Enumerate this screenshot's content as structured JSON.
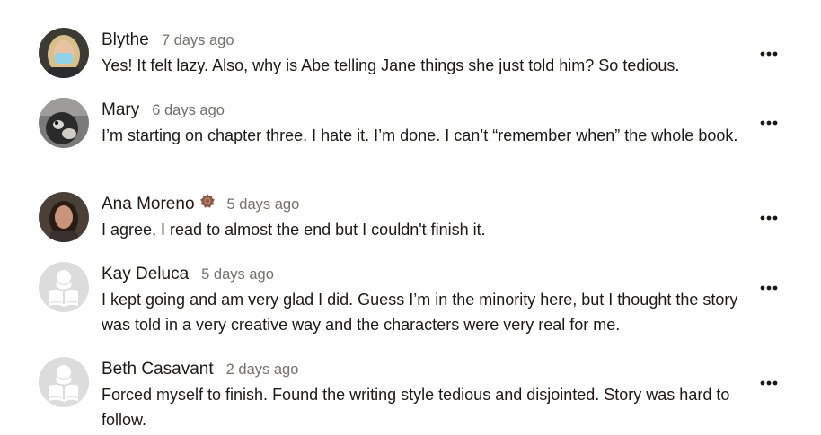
{
  "comments": [
    {
      "author": "Blythe",
      "time": "7 days ago",
      "text": "Yes! It felt lazy. Also, why is Abe telling Jane things she just told him? So tedious.",
      "avatar": "photo"
    },
    {
      "author": "Mary",
      "time": "6 days ago",
      "text": "I’m starting on chapter three. I hate it. I’m done. I can’t “remember when” the whole book.",
      "avatar": "photo"
    },
    {
      "author": "Ana Moreno",
      "time": "5 days ago",
      "text": "I agree, I read to almost the end but I couldn't finish it.",
      "avatar": "photo",
      "badge": "author-badge-icon"
    },
    {
      "author": "Kay Deluca",
      "time": "5 days ago",
      "text": "I kept going and am very glad I did. Guess I’m in the minority here, but I thought the story was told in a very creative way and the characters were very real for me.",
      "avatar": "default-reader-icon"
    },
    {
      "author": "Beth Casavant",
      "time": "2 days ago",
      "text": "Forced myself to finish. Found the writing style tedious and disjointed. Story was hard to follow.",
      "avatar": "default-reader-icon"
    }
  ],
  "colors": {
    "text": "#1e1915",
    "muted": "#76706b",
    "badge": "#8c5a46",
    "default_avatar_bg": "#dcdcdc"
  },
  "icons": {
    "more": "more-options-icon",
    "badge": "author-badge-icon",
    "default_avatar": "default-reader-icon"
  }
}
